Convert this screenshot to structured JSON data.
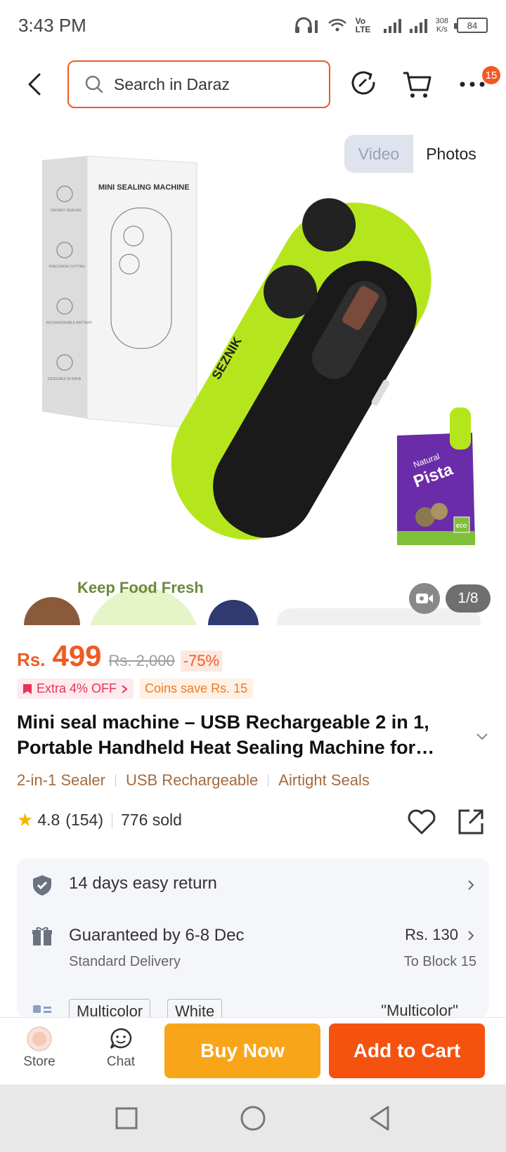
{
  "status_bar": {
    "time": "3:43 PM",
    "network_label": "Vo LTE",
    "net_speed_value": "308",
    "net_speed_unit": "K/s",
    "battery": "84"
  },
  "header": {
    "search_placeholder": "Search in Daraz",
    "cart_badge": "15"
  },
  "gallery": {
    "toggle_video": "Video",
    "toggle_photos": "Photos",
    "box_label": "MINI SEALING MACHINE",
    "box_feature_1": "INSTANT SEALING",
    "box_feature_2": "PRECISION CUTTING",
    "box_feature_3": "RECHARGEABLE BATTERY",
    "box_feature_4": "DESIGNED IN INDIA",
    "brand": "SEZNIK",
    "bag_word_1": "Natural",
    "bag_word_2": "Pista",
    "bag_badge": "ECO",
    "caption": "Keep Food Fresh",
    "counter": "1/8"
  },
  "product": {
    "currency": "Rs.",
    "price": "499",
    "original_price": "Rs. 2,000",
    "discount": "-75%",
    "promo_extra": "Extra 4% OFF",
    "promo_coins": "Coins save Rs. 15",
    "title": "Mini seal machine – USB Rechargeable 2 in 1, Portable Handheld Heat Sealing Machine for…",
    "tags": [
      "2-in-1 Sealer",
      "USB Rechargeable",
      "Airtight Seals"
    ],
    "rating": "4.8",
    "reviews": "(154)",
    "sold": "776 sold"
  },
  "info": {
    "return_text": "14 days easy return",
    "delivery_text": "Guaranteed by 6-8 Dec",
    "delivery_sub": "Standard Delivery",
    "delivery_fee": "Rs. 130",
    "delivery_location": "To Block 15",
    "variant_1": "Multicolor",
    "variant_2": "White",
    "selected_variant": "\"Multicolor\""
  },
  "bottom_bar": {
    "store_label": "Store",
    "chat_label": "Chat",
    "buy_now": "Buy Now",
    "add_to_cart": "Add to Cart"
  },
  "colors": {
    "accent": "#f05a22",
    "buy_now": "#f9a51a",
    "add_to_cart": "#f5520f",
    "product_green": "#b5e61d"
  }
}
